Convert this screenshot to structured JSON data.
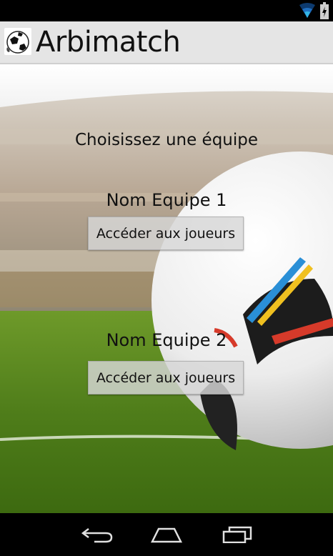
{
  "app": {
    "title": "Arbimatch",
    "logo_icon": "soccer-ball-logo-icon"
  },
  "status_bar": {
    "icons": [
      "wifi-icon",
      "battery-icon"
    ],
    "accent": "#33b5e5"
  },
  "main": {
    "prompt": "Choisissez une équipe",
    "teams": [
      {
        "name": "Nom Equipe 1",
        "button_label": "Accéder aux joueurs"
      },
      {
        "name": "Nom Equipe 2",
        "button_label": "Accéder aux joueurs"
      }
    ]
  },
  "nav_bar": {
    "icons": [
      "back-icon",
      "home-icon",
      "recents-icon"
    ]
  }
}
